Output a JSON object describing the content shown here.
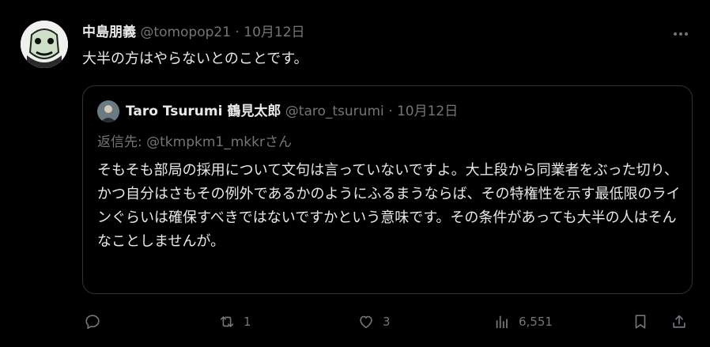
{
  "tweet": {
    "author_name": "中島朋義",
    "handle": "@tomopop21",
    "separator": "·",
    "date": "10月12日",
    "text": "大半の方はやらないとのことです。"
  },
  "quote": {
    "author_name": "Taro Tsurumi 鶴見太郎",
    "handle": "@taro_tsurumi",
    "separator": "·",
    "date": "10月12日",
    "reply_prefix": "返信先: ",
    "reply_to": "@tkmpkm1_mkkr",
    "reply_suffix": "さん",
    "text": "そもそも部局の採用について文句は言っていないですよ。大上段から同業者をぶった切り、かつ自分はさもその例外であるかのようにふるまうならば、その特権性を示す最低限のラインぐらいは確保すべきではないですかという意味です。その条件があっても大半の人はそんなことしませんが。"
  },
  "actions": {
    "reply_count": "",
    "repost_count": "1",
    "like_count": "3",
    "views_count": "6,551"
  },
  "icons": {
    "more": "more-horizontal-icon",
    "reply": "reply-icon",
    "repost": "repost-icon",
    "like": "heart-icon",
    "views": "views-icon",
    "bookmark": "bookmark-icon",
    "share": "share-icon"
  },
  "colors": {
    "background": "#000000",
    "text": "#e7e9ea",
    "muted": "#71767b",
    "border": "#2f3336"
  }
}
